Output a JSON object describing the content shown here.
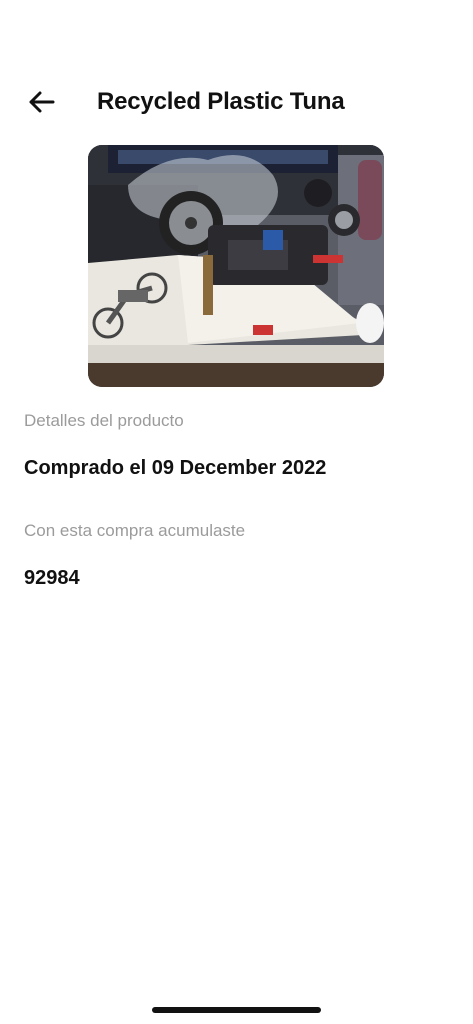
{
  "header": {
    "title": "Recycled Plastic Tuna",
    "back_icon": "arrow-left-icon"
  },
  "product": {
    "image_subject": "motorcycle-model-photo",
    "details_label": "Detalles del producto",
    "purchase_text": "Comprado el 09 December 2022",
    "accumulated_label": "Con esta compra acumulaste",
    "accumulated_value": "92984"
  }
}
